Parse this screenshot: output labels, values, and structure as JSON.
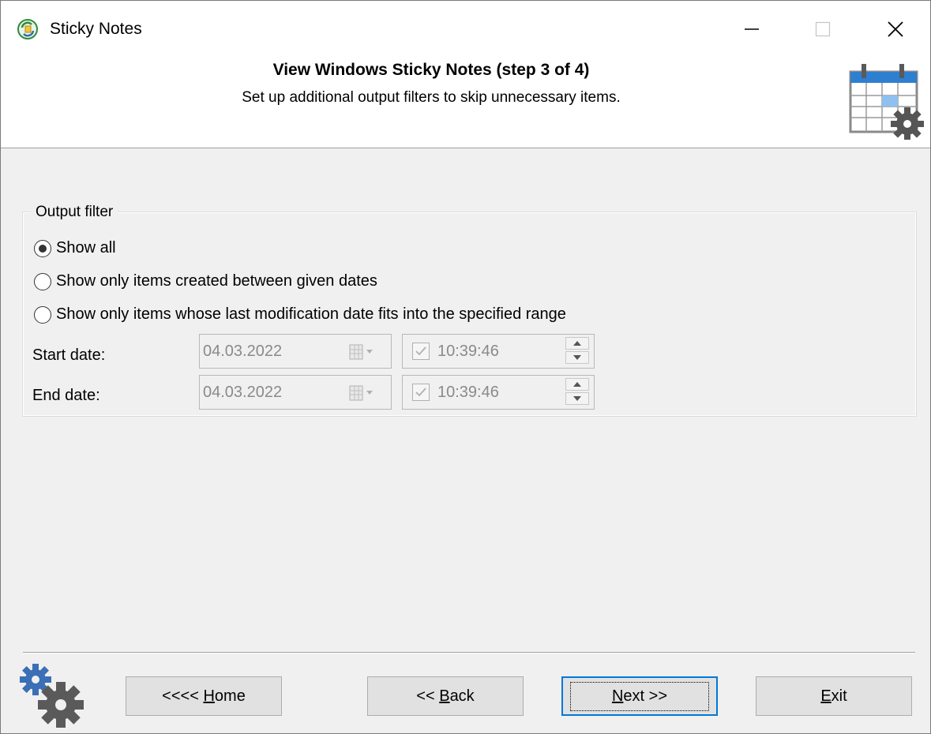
{
  "window": {
    "title": "Sticky Notes",
    "controls": {
      "minimize": "minimize",
      "maximize": "maximize",
      "close": "close"
    }
  },
  "header": {
    "title": "View Windows Sticky Notes (step 3 of 4)",
    "subtitle": "Set up additional output filters to skip unnecessary items."
  },
  "filter": {
    "legend": "Output filter",
    "options": [
      {
        "label": "Show all",
        "checked": true
      },
      {
        "label": "Show only items created between given dates",
        "checked": false
      },
      {
        "label": "Show only items whose last modification date fits into the specified range",
        "checked": false
      }
    ],
    "start": {
      "label": "Start date:",
      "date": "04.03.2022",
      "time": "10:39:46"
    },
    "end": {
      "label": "End date:",
      "date": "04.03.2022",
      "time": "10:39:46"
    }
  },
  "buttons": {
    "home": {
      "prefix": "<<<< ",
      "accel": "H",
      "rest": "ome"
    },
    "back": {
      "prefix": "<< ",
      "accel": "B",
      "rest": "ack"
    },
    "next": {
      "prefix": "",
      "accel": "N",
      "rest": "ext >>"
    },
    "exit": {
      "prefix": "",
      "accel": "E",
      "rest": "xit"
    }
  },
  "colors": {
    "accent": "#0078d7",
    "gear": "#5a5a5a",
    "gear_blue": "#3b6fb6"
  }
}
